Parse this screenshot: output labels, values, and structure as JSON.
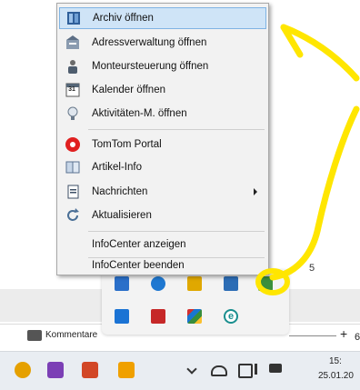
{
  "context_menu": {
    "items": [
      {
        "label": "Archiv öffnen",
        "icon": "archive-icon"
      },
      {
        "label": "Adressverwaltung öffnen",
        "icon": "address-book-icon"
      },
      {
        "label": "Monteursteuerung öffnen",
        "icon": "technician-icon"
      },
      {
        "label": "Kalender öffnen",
        "icon": "calendar-icon",
        "icon_text": "31"
      },
      {
        "label": "Aktivitäten-M. öffnen",
        "icon": "lightbulb-icon"
      },
      {
        "label": "TomTom Portal",
        "icon": "tomtom-icon"
      },
      {
        "label": "Artikel-Info",
        "icon": "book-icon"
      },
      {
        "label": "Nachrichten",
        "icon": "document-icon"
      },
      {
        "label": "Aktualisieren",
        "icon": "refresh-icon"
      },
      {
        "label": "InfoCenter anzeigen"
      },
      {
        "label": "InfoCenter beenden"
      }
    ]
  },
  "background": {
    "page_number": "5",
    "comment_label": "Kommentare",
    "zoom_plus": "+",
    "zoom_digit": "6"
  },
  "tray": {
    "edge_icon_letter": "e"
  },
  "taskbar": {
    "time": "15:",
    "date": "25.01.20"
  },
  "colors": {
    "highlight": "#cfe4f7",
    "highlight_border": "#7fb3e3",
    "annotation": "#ffe600"
  }
}
